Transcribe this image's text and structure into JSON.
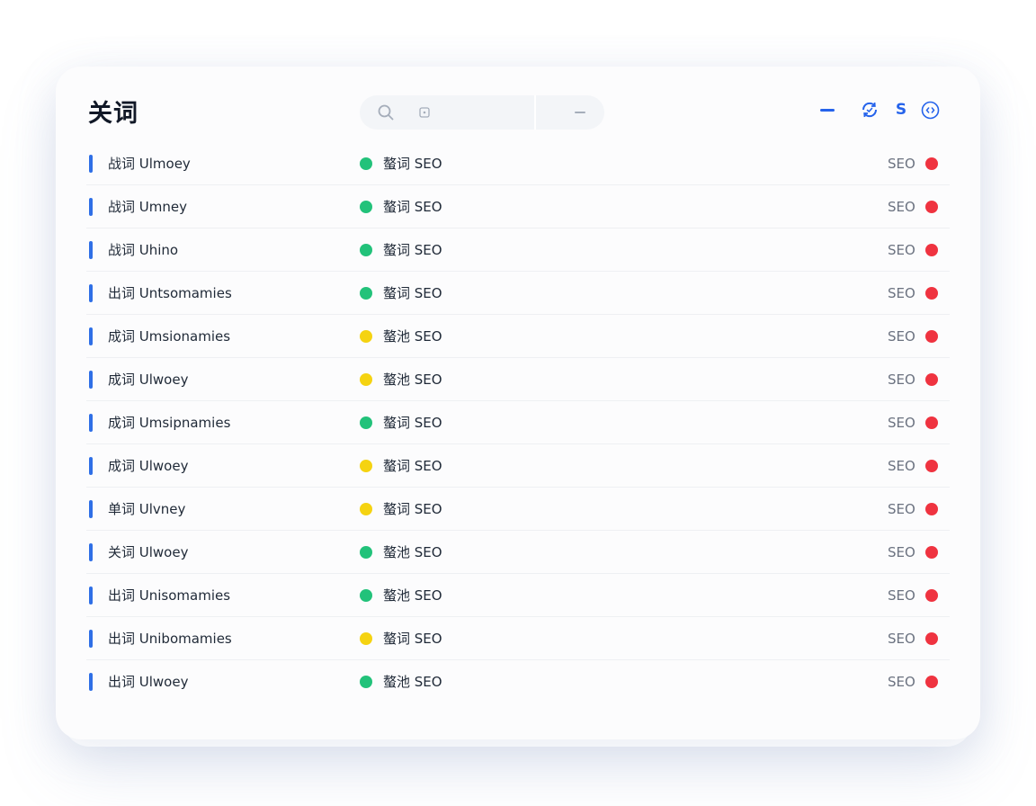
{
  "header": {
    "title": "关词"
  },
  "search": {
    "icon": "search-icon"
  },
  "toolbar": {
    "s_label": "S",
    "accent_color": "#2563eb"
  },
  "colors": {
    "green": "#22c27a",
    "yellow": "#f5d311",
    "red": "#ef3340",
    "bar": "#2f6fe6"
  },
  "rows": [
    {
      "name": "战词 Ulmoey",
      "status_color": "green",
      "status_text": "螯词 SEO",
      "seo_label": "SEO"
    },
    {
      "name": "战词 Umney",
      "status_color": "green",
      "status_text": "螯词 SEO",
      "seo_label": "SEO"
    },
    {
      "name": "战词 Uhino",
      "status_color": "green",
      "status_text": "螯词 SEO",
      "seo_label": "SEO"
    },
    {
      "name": "出词 Untsomamies",
      "status_color": "green",
      "status_text": "螯词 SEO",
      "seo_label": "SEO"
    },
    {
      "name": "成词 Umsionamies",
      "status_color": "yellow",
      "status_text": "螯池 SEO",
      "seo_label": "SEO"
    },
    {
      "name": "成词 Ulwoey",
      "status_color": "yellow",
      "status_text": "螯池 SEO",
      "seo_label": "SEO"
    },
    {
      "name": "成词 Umsipnamies",
      "status_color": "green",
      "status_text": "螯词 SEO",
      "seo_label": "SEO"
    },
    {
      "name": "成词 Ulwoey",
      "status_color": "yellow",
      "status_text": "螯词 SEO",
      "seo_label": "SEO"
    },
    {
      "name": "单词 Ulvney",
      "status_color": "yellow",
      "status_text": "螯词 SEO",
      "seo_label": "SEO"
    },
    {
      "name": "关词 Ulwoey",
      "status_color": "green",
      "status_text": "螯池 SEO",
      "seo_label": "SEO"
    },
    {
      "name": "出词 Unisomamies",
      "status_color": "green",
      "status_text": "螯池 SEO",
      "seo_label": "SEO"
    },
    {
      "name": "出词 Unibomamies",
      "status_color": "yellow",
      "status_text": "螯词 SEO",
      "seo_label": "SEO"
    },
    {
      "name": "出词 Ulwoey",
      "status_color": "green",
      "status_text": "螯池 SEO",
      "seo_label": "SEO"
    }
  ]
}
